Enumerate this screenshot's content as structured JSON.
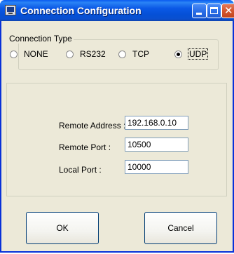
{
  "window": {
    "title": "Connection Configuration",
    "icon": "terminal-icon",
    "controls": {
      "minimize": "minimize-icon",
      "maximize": "maximize-icon",
      "close_glyph": "✕"
    }
  },
  "connection_type": {
    "label": "Connection Type",
    "options": [
      {
        "label": "NONE",
        "checked": false
      },
      {
        "label": "RS232",
        "checked": false
      },
      {
        "label": "TCP",
        "checked": false
      },
      {
        "label": "UDP",
        "checked": true
      }
    ]
  },
  "fields": {
    "remote_address": {
      "label": "Remote Address :",
      "value": "192.168.0.10"
    },
    "remote_port": {
      "label": "Remote Port :",
      "value": "10500"
    },
    "local_port": {
      "label": "Local Port :",
      "value": "10000"
    }
  },
  "buttons": {
    "ok": "OK",
    "cancel": "Cancel"
  },
  "colors": {
    "titlebar": "#0a58e6",
    "window_frame": "#0831d9",
    "dialog_background": "#ece9d8"
  }
}
